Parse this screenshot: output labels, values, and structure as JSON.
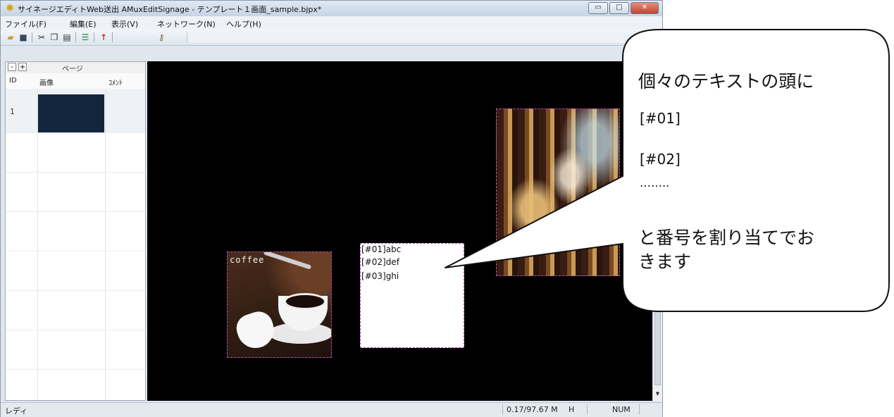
{
  "window": {
    "title": "サイネージエディトWeb送出 AMuxEditSignage - テンプレート１画面_sample.bjpx*",
    "controls": {
      "minimize": "▭",
      "maximize": "□",
      "close": "✕"
    }
  },
  "menu": [
    "ファイル(F)",
    "編集(E)",
    "表示(V)",
    "ネットワーク(N)",
    "ヘルプ(H)"
  ],
  "toolbar": {
    "icons": [
      "open-icon",
      "save-icon",
      "cut-icon",
      "copy-icon",
      "paste-icon",
      "layout-icon",
      "upload-icon",
      "key-icon"
    ]
  },
  "sidebar": {
    "collapse_label": "-",
    "expand_label": "+",
    "title": "ページ",
    "columns": [
      "ID",
      "画像",
      "ｺﾒﾝﾄ"
    ],
    "rows": [
      {
        "id": "1",
        "image_color": "#13263d",
        "comment": ""
      }
    ]
  },
  "canvas": {
    "coffee_label": "coffee",
    "text_lines": [
      "[#01]abc",
      "[#02]def",
      "[#03]ghi"
    ]
  },
  "status": {
    "ready": "レディ",
    "usage": "0.17/97.67 M",
    "mode": "H",
    "num": "NUM"
  },
  "callout": {
    "line1": "個々のテキストの頭に",
    "line2": "[#01]",
    "line3": "[#02]",
    "line4": "……..",
    "line5": "と番号を割り当てでお",
    "line6": "きます"
  }
}
